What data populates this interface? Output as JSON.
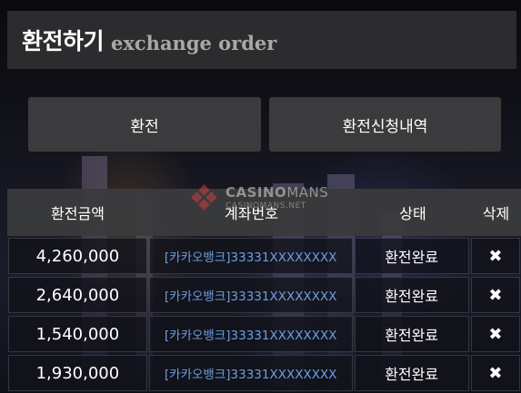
{
  "header": {
    "title_ko": "환전하기",
    "title_en": "exchange order"
  },
  "tabs": [
    {
      "label": "환전"
    },
    {
      "label": "환전신청내역"
    }
  ],
  "table": {
    "columns": [
      "환전금액",
      "계좌번호",
      "상태",
      "삭제"
    ],
    "rows": [
      {
        "amount": "4,260,000",
        "account": "[카카오뱅크]33331XXXXXXXX",
        "status": "환전완료",
        "delete": "✖"
      },
      {
        "amount": "2,640,000",
        "account": "[카카오뱅크]33331XXXXXXXX",
        "status": "환전완료",
        "delete": "✖"
      },
      {
        "amount": "1,540,000",
        "account": "[카카오뱅크]33331XXXXXXXX",
        "status": "환전완료",
        "delete": "✖"
      },
      {
        "amount": "1,930,000",
        "account": "[카카오뱅크]33331XXXXXXXX",
        "status": "환전완료",
        "delete": "✖"
      }
    ]
  },
  "watermark": {
    "brand_bold": "CASINO",
    "brand_light": "MANS",
    "domain": "CASINOMANS.NET"
  },
  "colors": {
    "header_bg": "#2c2c2e",
    "tab_bg": "#3b3b3d",
    "account_text": "#6a9fe0",
    "logo_red": "#c94040"
  }
}
